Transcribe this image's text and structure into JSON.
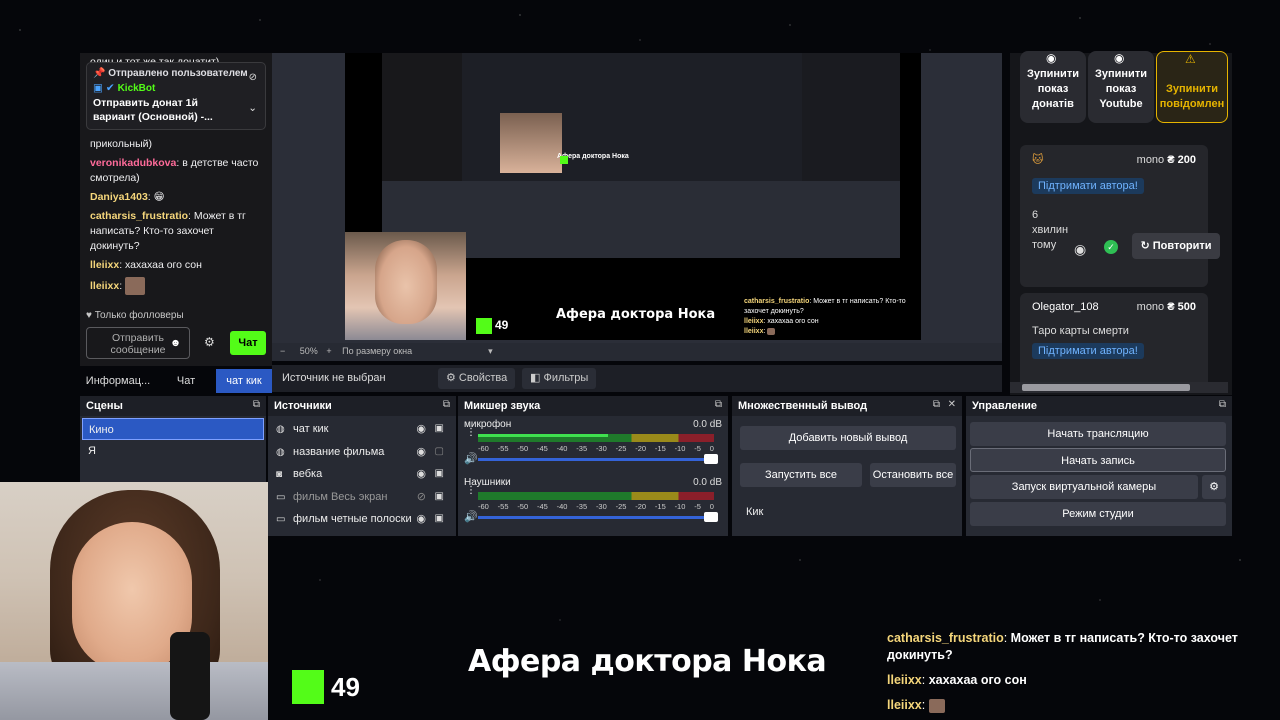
{
  "chat": {
    "top_cut": "один и тот же так донатит)",
    "pinned_head": "Отправлено пользователем",
    "pinned_user": "KickBot",
    "pinned_text": "Отправить донат 1й вариант (Основной) -...",
    "msg0_tail": "прикольный)",
    "messages": [
      {
        "user": "veronikadubkova",
        "color": "#ff6b9a",
        "text": "в детстве часто смотрела)"
      },
      {
        "user": "Daniya1403",
        "color": "#f5d67b",
        "text": "😁"
      },
      {
        "user": "catharsis_frustratio",
        "color": "#f5d67b",
        "text": "Может в тг написать? Кто-то захочет докинуть?"
      },
      {
        "user": "lleiixx",
        "color": "#f5d67b",
        "text": "хахахаа ого сон"
      },
      {
        "user": "lleiixx",
        "color": "#f5d67b",
        "text": ""
      }
    ],
    "followers_only": "Только фолловеры",
    "send_placeholder": "Отправить сообщение",
    "chat_button": "Чат"
  },
  "tabs": [
    "Информац...",
    "Чат",
    "чат кик"
  ],
  "preview": {
    "zoom": "50%",
    "fit": "По размеру окна",
    "no_source": "Источник не выбран",
    "properties": "Свойства",
    "filters": "Фильтры",
    "viewer_count": "49",
    "stream_title": "Афера доктора Нока",
    "nested_chat": [
      {
        "user": "catharsis_frustratio",
        "text": "Может в тг написать? Кто-то захочет докинуть?"
      },
      {
        "user": "lleiixx",
        "text": "хахахаа ого сон"
      },
      {
        "user": "lleiixx",
        "text": ""
      }
    ]
  },
  "donations": {
    "stop_donations": "Зупинити показ донатів",
    "stop_youtube": "Зупинити показ Youtube",
    "stop_messages": "Зупинити повідомлен",
    "card1": {
      "source": "mono",
      "amount": "₴ 200",
      "link": "Підтримати автора!",
      "time_num": "6",
      "time_unit": "хвилин",
      "time_ago": "тому",
      "repeat": "Повторити"
    },
    "card2": {
      "user": "Olegator_108",
      "source": "mono",
      "amount": "₴ 500",
      "message": "Таро карты смерти",
      "link": "Підтримати автора!"
    }
  },
  "scenes": {
    "title": "Сцены",
    "items": [
      "Кино",
      "Я"
    ]
  },
  "sources": {
    "title": "Источники",
    "items": [
      {
        "name": "чат кик",
        "icon": "globe-icon",
        "dim": false
      },
      {
        "name": "название фильма",
        "icon": "globe-icon",
        "dim": false
      },
      {
        "name": "вебка",
        "icon": "camera-icon",
        "dim": false
      },
      {
        "name": "фильм Весь экран",
        "icon": "window-icon",
        "dim": true
      },
      {
        "name": "фильм четные полоски",
        "icon": "window-icon",
        "dim": false
      }
    ]
  },
  "mixer": {
    "title": "Микшер звука",
    "channels": [
      {
        "name": "микрофон",
        "db": "0.0 dB",
        "level": 0.55
      },
      {
        "name": "Наушники",
        "db": "0.0 dB",
        "level": 0.0
      }
    ],
    "ticks": [
      "-60",
      "-55",
      "-50",
      "-45",
      "-40",
      "-35",
      "-30",
      "-25",
      "-20",
      "-15",
      "-10",
      "-5",
      "0"
    ]
  },
  "multi_output": {
    "title": "Множественный вывод",
    "add": "Добавить новый вывод",
    "start_all": "Запустить все",
    "stop_all": "Остановить все",
    "target": "Кик"
  },
  "controls": {
    "title": "Управление",
    "start_stream": "Начать трансляцию",
    "start_record": "Начать запись",
    "virtual_cam": "Запуск виртуальной камеры",
    "studio_mode": "Режим студии"
  },
  "overlay": {
    "viewer_count": "49",
    "title": "Афера доктора Нока",
    "chat": [
      {
        "user": "catharsis_frustratio",
        "text": "Может в тг написать? Кто-то захочет докинуть?"
      },
      {
        "user": "lleiixx",
        "text": "хахахаа ого сон"
      },
      {
        "user": "lleiixx",
        "text": ""
      }
    ]
  }
}
